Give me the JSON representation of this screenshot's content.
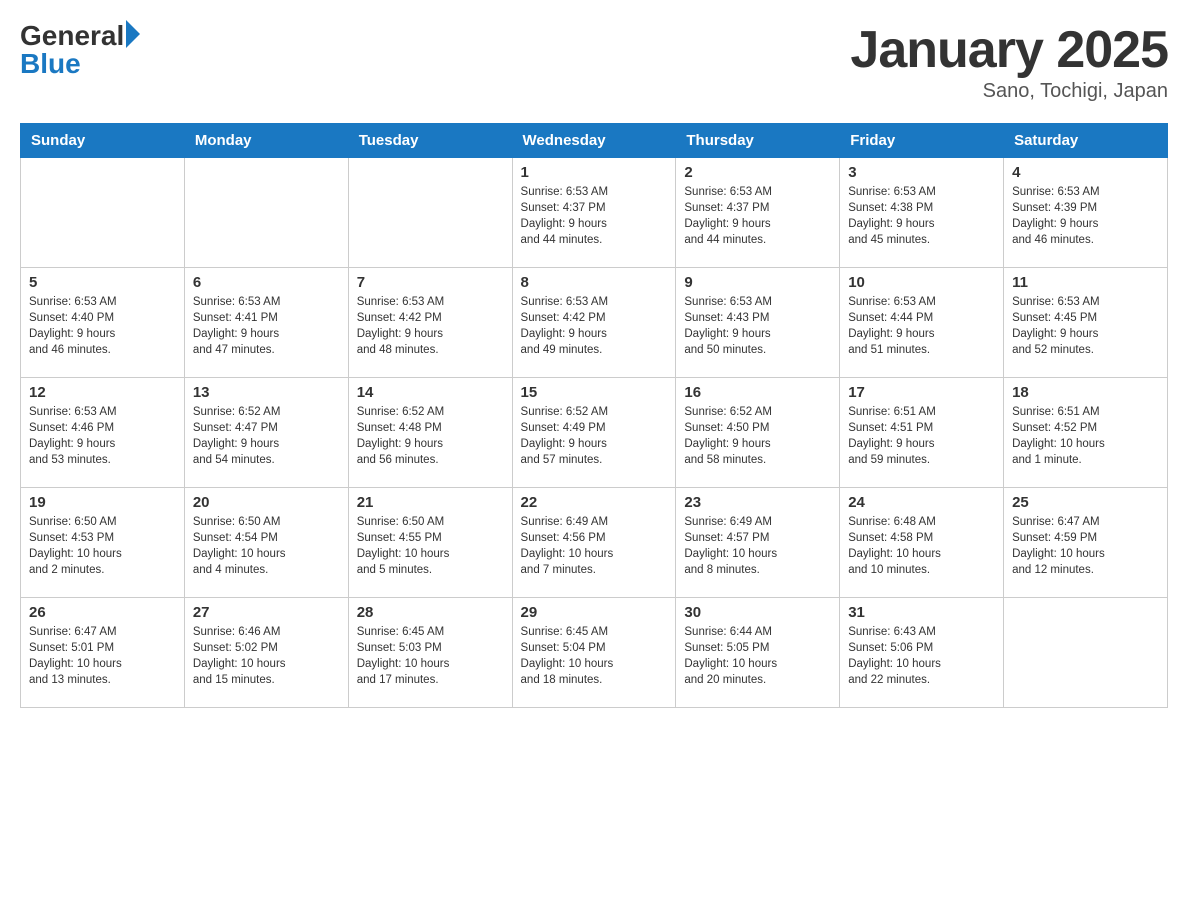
{
  "header": {
    "title": "January 2025",
    "location": "Sano, Tochigi, Japan"
  },
  "days_of_week": [
    "Sunday",
    "Monday",
    "Tuesday",
    "Wednesday",
    "Thursday",
    "Friday",
    "Saturday"
  ],
  "weeks": [
    [
      {
        "day": "",
        "info": ""
      },
      {
        "day": "",
        "info": ""
      },
      {
        "day": "",
        "info": ""
      },
      {
        "day": "1",
        "info": "Sunrise: 6:53 AM\nSunset: 4:37 PM\nDaylight: 9 hours\nand 44 minutes."
      },
      {
        "day": "2",
        "info": "Sunrise: 6:53 AM\nSunset: 4:37 PM\nDaylight: 9 hours\nand 44 minutes."
      },
      {
        "day": "3",
        "info": "Sunrise: 6:53 AM\nSunset: 4:38 PM\nDaylight: 9 hours\nand 45 minutes."
      },
      {
        "day": "4",
        "info": "Sunrise: 6:53 AM\nSunset: 4:39 PM\nDaylight: 9 hours\nand 46 minutes."
      }
    ],
    [
      {
        "day": "5",
        "info": "Sunrise: 6:53 AM\nSunset: 4:40 PM\nDaylight: 9 hours\nand 46 minutes."
      },
      {
        "day": "6",
        "info": "Sunrise: 6:53 AM\nSunset: 4:41 PM\nDaylight: 9 hours\nand 47 minutes."
      },
      {
        "day": "7",
        "info": "Sunrise: 6:53 AM\nSunset: 4:42 PM\nDaylight: 9 hours\nand 48 minutes."
      },
      {
        "day": "8",
        "info": "Sunrise: 6:53 AM\nSunset: 4:42 PM\nDaylight: 9 hours\nand 49 minutes."
      },
      {
        "day": "9",
        "info": "Sunrise: 6:53 AM\nSunset: 4:43 PM\nDaylight: 9 hours\nand 50 minutes."
      },
      {
        "day": "10",
        "info": "Sunrise: 6:53 AM\nSunset: 4:44 PM\nDaylight: 9 hours\nand 51 minutes."
      },
      {
        "day": "11",
        "info": "Sunrise: 6:53 AM\nSunset: 4:45 PM\nDaylight: 9 hours\nand 52 minutes."
      }
    ],
    [
      {
        "day": "12",
        "info": "Sunrise: 6:53 AM\nSunset: 4:46 PM\nDaylight: 9 hours\nand 53 minutes."
      },
      {
        "day": "13",
        "info": "Sunrise: 6:52 AM\nSunset: 4:47 PM\nDaylight: 9 hours\nand 54 minutes."
      },
      {
        "day": "14",
        "info": "Sunrise: 6:52 AM\nSunset: 4:48 PM\nDaylight: 9 hours\nand 56 minutes."
      },
      {
        "day": "15",
        "info": "Sunrise: 6:52 AM\nSunset: 4:49 PM\nDaylight: 9 hours\nand 57 minutes."
      },
      {
        "day": "16",
        "info": "Sunrise: 6:52 AM\nSunset: 4:50 PM\nDaylight: 9 hours\nand 58 minutes."
      },
      {
        "day": "17",
        "info": "Sunrise: 6:51 AM\nSunset: 4:51 PM\nDaylight: 9 hours\nand 59 minutes."
      },
      {
        "day": "18",
        "info": "Sunrise: 6:51 AM\nSunset: 4:52 PM\nDaylight: 10 hours\nand 1 minute."
      }
    ],
    [
      {
        "day": "19",
        "info": "Sunrise: 6:50 AM\nSunset: 4:53 PM\nDaylight: 10 hours\nand 2 minutes."
      },
      {
        "day": "20",
        "info": "Sunrise: 6:50 AM\nSunset: 4:54 PM\nDaylight: 10 hours\nand 4 minutes."
      },
      {
        "day": "21",
        "info": "Sunrise: 6:50 AM\nSunset: 4:55 PM\nDaylight: 10 hours\nand 5 minutes."
      },
      {
        "day": "22",
        "info": "Sunrise: 6:49 AM\nSunset: 4:56 PM\nDaylight: 10 hours\nand 7 minutes."
      },
      {
        "day": "23",
        "info": "Sunrise: 6:49 AM\nSunset: 4:57 PM\nDaylight: 10 hours\nand 8 minutes."
      },
      {
        "day": "24",
        "info": "Sunrise: 6:48 AM\nSunset: 4:58 PM\nDaylight: 10 hours\nand 10 minutes."
      },
      {
        "day": "25",
        "info": "Sunrise: 6:47 AM\nSunset: 4:59 PM\nDaylight: 10 hours\nand 12 minutes."
      }
    ],
    [
      {
        "day": "26",
        "info": "Sunrise: 6:47 AM\nSunset: 5:01 PM\nDaylight: 10 hours\nand 13 minutes."
      },
      {
        "day": "27",
        "info": "Sunrise: 6:46 AM\nSunset: 5:02 PM\nDaylight: 10 hours\nand 15 minutes."
      },
      {
        "day": "28",
        "info": "Sunrise: 6:45 AM\nSunset: 5:03 PM\nDaylight: 10 hours\nand 17 minutes."
      },
      {
        "day": "29",
        "info": "Sunrise: 6:45 AM\nSunset: 5:04 PM\nDaylight: 10 hours\nand 18 minutes."
      },
      {
        "day": "30",
        "info": "Sunrise: 6:44 AM\nSunset: 5:05 PM\nDaylight: 10 hours\nand 20 minutes."
      },
      {
        "day": "31",
        "info": "Sunrise: 6:43 AM\nSunset: 5:06 PM\nDaylight: 10 hours\nand 22 minutes."
      },
      {
        "day": "",
        "info": ""
      }
    ]
  ]
}
